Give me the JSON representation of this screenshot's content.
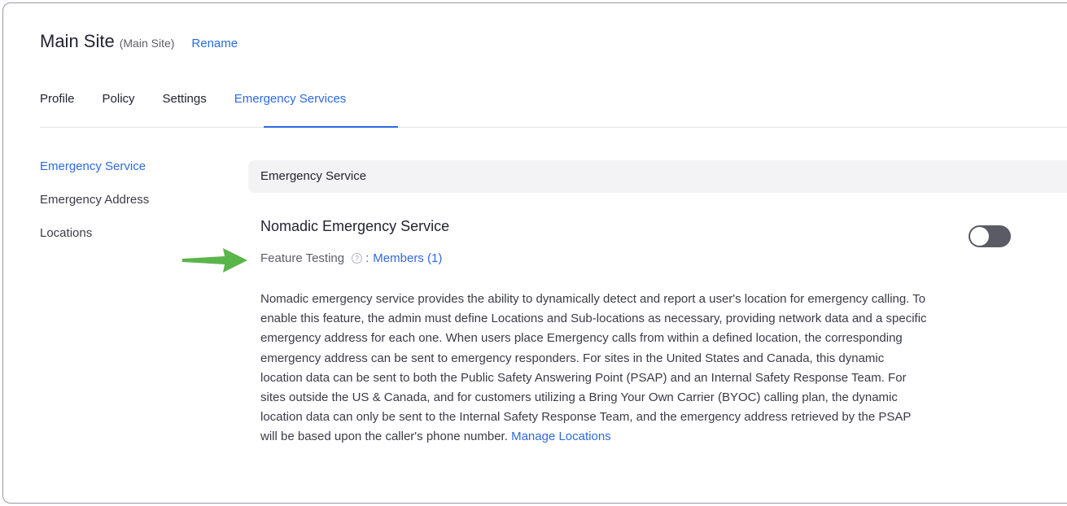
{
  "header": {
    "site_name": "Main Site",
    "site_sub": "(Main Site)",
    "rename_label": "Rename"
  },
  "tabs": [
    {
      "label": "Profile",
      "active": false
    },
    {
      "label": "Policy",
      "active": false
    },
    {
      "label": "Settings",
      "active": false
    },
    {
      "label": "Emergency Services",
      "active": true
    }
  ],
  "sidebar": {
    "items": [
      {
        "label": "Emergency Service",
        "active": true
      },
      {
        "label": "Emergency Address",
        "active": false
      },
      {
        "label": "Locations",
        "active": false
      }
    ]
  },
  "section": {
    "header": "Emergency Service",
    "feature_title": "Nomadic Emergency Service",
    "toggle_on": false,
    "testing_label": "Feature Testing",
    "help_glyph": "?",
    "colon": ":",
    "members_link": "Members (1)",
    "description": "Nomadic emergency service provides the ability to dynamically detect and report a user's location for emergency calling. To enable this feature, the admin must define Locations and Sub-locations as necessary, providing network data and a specific emergency address for each one. When users place Emergency calls from within a defined location, the corresponding emergency address can be sent to emergency responders. For sites in the United States and Canada, this dynamic location data can be sent to both the Public Safety Answering Point (PSAP) and an Internal Safety Response Team. For sites outside the US & Canada, and for customers utilizing a Bring Your Own Carrier (BYOC) calling plan, the dynamic location data can only be sent to the Internal Safety Response Team, and the emergency address retrieved by the PSAP will be based upon the caller's phone number.",
    "manage_link": "Manage Locations"
  },
  "colors": {
    "accent": "#2d6ae0",
    "arrow": "#5ab54b",
    "toggle_off": "#5b5b66"
  },
  "icons": {
    "help": "question-circle-icon",
    "arrow": "green-arrow-icon"
  }
}
